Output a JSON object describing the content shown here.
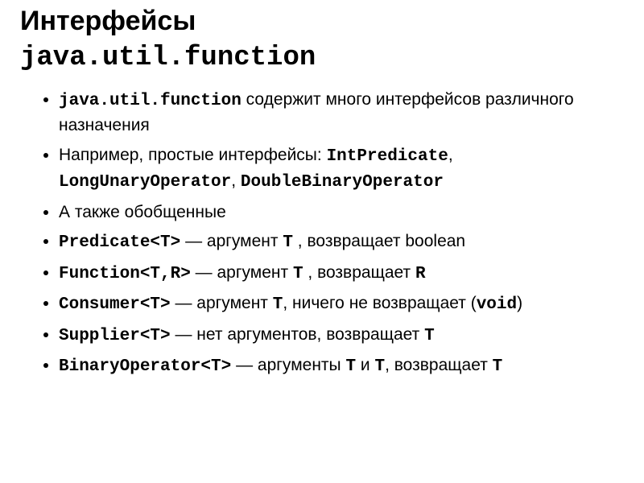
{
  "title": {
    "line1": "Интерфейсы",
    "line2": "java.util.function"
  },
  "b0": {
    "p1": "java.util.function",
    "p2": " содержит много интерфейсов различного назначения"
  },
  "b1": {
    "p1": "Например, простые интерфейсы: ",
    "p2": "IntPredicate",
    "p3": ", ",
    "p4": "LongUnaryOperator",
    "p5": ", ",
    "p6": "DoubleBinaryOperator"
  },
  "b2": {
    "p1": "А также обобщенные"
  },
  "b3": {
    "p1": "Predicate<T>",
    "p2": " — аргумент ",
    "p3": "T",
    "p4": " , возвращает boolean"
  },
  "b4": {
    "p1": "Function<T,R>",
    "p2": " — аргумент ",
    "p3": "T",
    "p4": " , возвращает ",
    "p5": "R"
  },
  "b5": {
    "p1": "Consumer<T>",
    "p2": " — аргумент ",
    "p3": "T",
    "p4": ", ничего не возвращает (",
    "p5": "void",
    "p6": ")"
  },
  "b6": {
    "p1": "Supplier<T>",
    "p2": " — нет аргументов, возвращает ",
    "p3": "T"
  },
  "b7": {
    "p1": "BinaryOperator<T>",
    "p2": " — аргументы ",
    "p3": "T",
    "p4": " и ",
    "p5": "T",
    "p6": ", возвращает ",
    "p7": "T"
  }
}
